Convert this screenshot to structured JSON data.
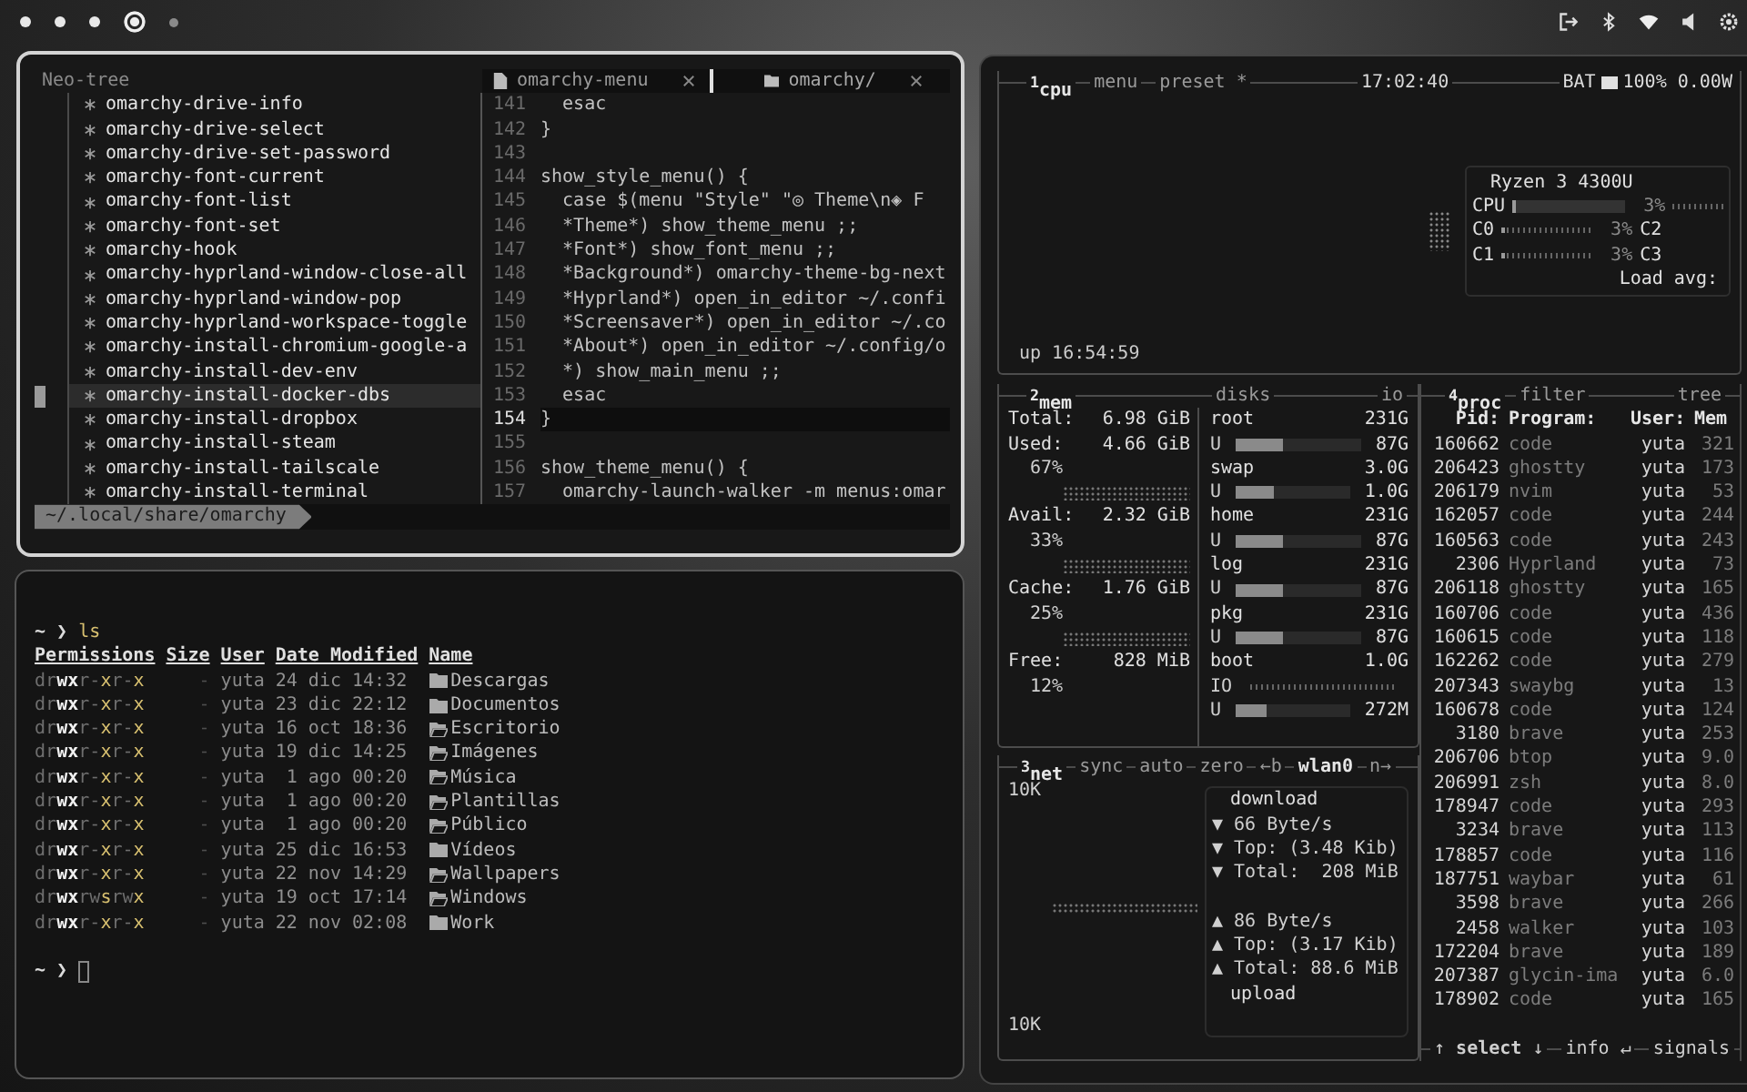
{
  "topbar": {
    "workspaces": [
      {
        "selected": false,
        "occupied": true
      },
      {
        "selected": false,
        "occupied": true
      },
      {
        "selected": false,
        "occupied": true
      },
      {
        "selected": true,
        "occupied": true
      },
      {
        "selected": false,
        "occupied": false
      }
    ]
  },
  "editor": {
    "tree_title": "Neo-tree",
    "tree_items": [
      {
        "label": "omarchy-drive-info",
        "selected": false
      },
      {
        "label": "omarchy-drive-select",
        "selected": false
      },
      {
        "label": "omarchy-drive-set-password",
        "selected": false
      },
      {
        "label": "omarchy-font-current",
        "selected": false
      },
      {
        "label": "omarchy-font-list",
        "selected": false
      },
      {
        "label": "omarchy-font-set",
        "selected": false
      },
      {
        "label": "omarchy-hook",
        "selected": false
      },
      {
        "label": "omarchy-hyprland-window-close-all",
        "selected": false
      },
      {
        "label": "omarchy-hyprland-window-pop",
        "selected": false
      },
      {
        "label": "omarchy-hyprland-workspace-toggle",
        "selected": false
      },
      {
        "label": "omarchy-install-chromium-google-a",
        "selected": false
      },
      {
        "label": "omarchy-install-dev-env",
        "selected": false
      },
      {
        "label": "omarchy-install-docker-dbs",
        "selected": true
      },
      {
        "label": "omarchy-install-dropbox",
        "selected": false
      },
      {
        "label": "omarchy-install-steam",
        "selected": false
      },
      {
        "label": "omarchy-install-tailscale",
        "selected": false
      },
      {
        "label": "omarchy-install-terminal",
        "selected": false
      }
    ],
    "tabs": [
      {
        "label": "omarchy-menu",
        "kind": "file",
        "selected": true
      },
      {
        "label": "omarchy/",
        "kind": "folder",
        "selected": false
      }
    ],
    "lines": [
      {
        "number": "141",
        "code": "  esac",
        "current": false
      },
      {
        "number": "142",
        "code": "}",
        "current": false
      },
      {
        "number": "143",
        "current": false
      },
      {
        "number": "144",
        "code": "show_style_menu() {",
        "current": false
      },
      {
        "number": "145",
        "code": "  case $(menu \"Style\" \"◎ Theme\\n◈ F",
        "current": false
      },
      {
        "number": "146",
        "code": "  *Theme*) show_theme_menu ;;",
        "current": false
      },
      {
        "number": "147",
        "code": "  *Font*) show_font_menu ;;",
        "current": false
      },
      {
        "number": "148",
        "code": "  *Background*) omarchy-theme-bg-next",
        "current": false
      },
      {
        "number": "149",
        "code": "  *Hyprland*) open_in_editor ~/.confi",
        "current": false
      },
      {
        "number": "150",
        "code": "  *Screensaver*) open_in_editor ~/.co",
        "current": false
      },
      {
        "number": "151",
        "code": "  *About*) open_in_editor ~/.config/o",
        "current": false
      },
      {
        "number": "152",
        "code": "  *) show_main_menu ;;",
        "current": false
      },
      {
        "number": "153",
        "code": "  esac",
        "current": false
      },
      {
        "number": "154",
        "code": "}",
        "current": true
      },
      {
        "number": "155",
        "current": false
      },
      {
        "number": "156",
        "code": "show_theme_menu() {",
        "current": false
      },
      {
        "number": "157",
        "code": "  omarchy-launch-walker -m menus:omar",
        "current": false
      }
    ],
    "path": "~/.local/share/omarchy"
  },
  "terminal": {
    "prompt": "~ ❯",
    "command": "ls",
    "columns": [
      "Permissions",
      "Size",
      "User",
      "Date Modified",
      "Name"
    ],
    "rows": [
      {
        "permissions": "drwxr-xr-x",
        "size": "-",
        "user": "yuta",
        "date": "24 dic 14:32",
        "name": "Descargas",
        "kind": "folder"
      },
      {
        "permissions": "drwxr-xr-x",
        "size": "-",
        "user": "yuta",
        "date": "23 dic 22:12",
        "name": "Documentos",
        "kind": "folder"
      },
      {
        "permissions": "drwxr-xr-x",
        "size": "-",
        "user": "yuta",
        "date": "16 oct 18:36",
        "name": "Escritorio",
        "kind": "folder-open"
      },
      {
        "permissions": "drwxr-xr-x",
        "size": "-",
        "user": "yuta",
        "date": "19 dic 14:25",
        "name": "Imágenes",
        "kind": "folder-open"
      },
      {
        "permissions": "drwxr-xr-x",
        "size": "-",
        "user": "yuta",
        "date": "1 ago 00:20",
        "name": "Música",
        "kind": "folder-open"
      },
      {
        "permissions": "drwxr-xr-x",
        "size": "-",
        "user": "yuta",
        "date": "1 ago 00:20",
        "name": "Plantillas",
        "kind": "folder-open"
      },
      {
        "permissions": "drwxr-xr-x",
        "size": "-",
        "user": "yuta",
        "date": "1 ago 00:20",
        "name": "Público",
        "kind": "folder-open"
      },
      {
        "permissions": "drwxr-xr-x",
        "size": "-",
        "user": "yuta",
        "date": "25 dic 16:53",
        "name": "Vídeos",
        "kind": "folder"
      },
      {
        "permissions": "drwxr-xr-x",
        "size": "-",
        "user": "yuta",
        "date": "22 nov 14:29",
        "name": "Wallpapers",
        "kind": "folder-open"
      },
      {
        "permissions": "drwxrwsrwx",
        "size": "-",
        "user": "yuta",
        "date": "19 oct 17:14",
        "name": "Windows",
        "kind": "folder-open"
      },
      {
        "permissions": "drwxr-xr-x",
        "size": "-",
        "user": "yuta",
        "date": "22 nov 02:08",
        "name": "Work",
        "kind": "folder"
      }
    ],
    "input_prompt": "~ ❯"
  },
  "btop": {
    "cpu": {
      "title": "$^{1}$cpu",
      "menu": "menu",
      "preset": "preset *",
      "clock": "17:02:40",
      "battery_label": "BAT",
      "battery_text": "100% 0.00W",
      "model": "Ryzen 3 4300U",
      "total": {
        "label": "CPU",
        "level": 0.03,
        "reading": "3%"
      },
      "cores": [
        {
          "label": "C0",
          "level": 0.03,
          "reading": "3%"
        },
        {
          "label": "C1",
          "level": 0.03,
          "reading": "3%"
        },
        {
          "label": "C2"
        },
        {
          "label": "C3"
        }
      ],
      "load": "Load avg:",
      "uptime": "up 16:54:59"
    },
    "mem": {
      "title": "$^{2}$mem",
      "stats": [
        {
          "label": "Total:",
          "value": "6.98 GiB"
        },
        {
          "label": "Used:",
          "value": "4.66 GiB",
          "percent": "67%"
        },
        {
          "label": "Avail:",
          "value": "2.32 GiB",
          "percent": "33%"
        },
        {
          "label": "Cache:",
          "value": "1.76 GiB",
          "percent": "25%"
        },
        {
          "label": "Free:",
          "value": "828 MiB",
          "percent": "12%"
        }
      ]
    },
    "disks": {
      "title": "disks",
      "io_title": "io",
      "items": [
        {
          "name": "root",
          "size": "231G",
          "bar_label": "U",
          "level": 0.38,
          "used": "87G"
        },
        {
          "name": "swap",
          "size": "3.0G",
          "bar_label": "U",
          "level": 0.33,
          "used": "1.0G"
        },
        {
          "name": "home",
          "size": "231G",
          "bar_label": "U",
          "level": 0.38,
          "used": "87G"
        },
        {
          "name": "log",
          "size": "231G",
          "bar_label": "U",
          "level": 0.38,
          "used": "87G"
        },
        {
          "name": "pkg",
          "size": "231G",
          "bar_label": "U",
          "level": 0.38,
          "used": "87G"
        },
        {
          "name": "boot",
          "size": "1.0G",
          "io": "IO",
          "bar_label": "U",
          "level": 0.27,
          "used": "272M"
        }
      ]
    },
    "net": {
      "title": "$^{3}$net",
      "options": [
        "sync",
        "auto",
        "zero"
      ],
      "prev": "←b",
      "interface": "wlan0",
      "next": "n→",
      "scale_top": "10K",
      "scale_bottom": "10K",
      "download": {
        "label": "download",
        "lines": [
          "▼ 66 Byte/s",
          "▼ Top: (3.48 Kib)",
          "▼ Total:  208 MiB"
        ]
      },
      "upload": {
        "lines": [
          "▲ 86 Byte/s",
          "▲ Top: (3.17 Kib)",
          "▲ Total: 88.6 MiB"
        ],
        "label": "upload"
      }
    },
    "proc": {
      "title": "$^{4}$proc",
      "filter": "filter",
      "tree": "tree",
      "columns": [
        "Pid:",
        "Program:",
        "User:",
        "Mem"
      ],
      "rows": [
        {
          "pid": "160662",
          "program": "code",
          "user": "yuta",
          "mem": "321"
        },
        {
          "pid": "206423",
          "program": "ghostty",
          "user": "yuta",
          "mem": "173"
        },
        {
          "pid": "206179",
          "program": "nvim",
          "user": "yuta",
          "mem": "53"
        },
        {
          "pid": "162057",
          "program": "code",
          "user": "yuta",
          "mem": "244"
        },
        {
          "pid": "160563",
          "program": "code",
          "user": "yuta",
          "mem": "243"
        },
        {
          "pid": "2306",
          "program": "Hyprland",
          "user": "yuta",
          "mem": "73"
        },
        {
          "pid": "206118",
          "program": "ghostty",
          "user": "yuta",
          "mem": "165"
        },
        {
          "pid": "160706",
          "program": "code",
          "user": "yuta",
          "mem": "436"
        },
        {
          "pid": "160615",
          "program": "code",
          "user": "yuta",
          "mem": "118"
        },
        {
          "pid": "162262",
          "program": "code",
          "user": "yuta",
          "mem": "279"
        },
        {
          "pid": "207343",
          "program": "swaybg",
          "user": "yuta",
          "mem": "13"
        },
        {
          "pid": "160678",
          "program": "code",
          "user": "yuta",
          "mem": "124"
        },
        {
          "pid": "3180",
          "program": "brave",
          "user": "yuta",
          "mem": "253"
        },
        {
          "pid": "206706",
          "program": "btop",
          "user": "yuta",
          "mem": "9.0"
        },
        {
          "pid": "206991",
          "program": "zsh",
          "user": "yuta",
          "mem": "8.0"
        },
        {
          "pid": "178947",
          "program": "code",
          "user": "yuta",
          "mem": "293"
        },
        {
          "pid": "3234",
          "program": "brave",
          "user": "yuta",
          "mem": "113"
        },
        {
          "pid": "178857",
          "program": "code",
          "user": "yuta",
          "mem": "116"
        },
        {
          "pid": "187751",
          "program": "waybar",
          "user": "yuta",
          "mem": "61"
        },
        {
          "pid": "3598",
          "program": "brave",
          "user": "yuta",
          "mem": "266"
        },
        {
          "pid": "2458",
          "program": "walker",
          "user": "yuta",
          "mem": "103"
        },
        {
          "pid": "172204",
          "program": "brave",
          "user": "yuta",
          "mem": "189"
        },
        {
          "pid": "207387",
          "program": "glycin-ima",
          "user": "yuta",
          "mem": "6.0"
        },
        {
          "pid": "178902",
          "program": "code",
          "user": "yuta",
          "mem": "165"
        }
      ],
      "footer": [
        "↑ **select** ↓",
        "info ↵",
        "signals"
      ]
    }
  }
}
